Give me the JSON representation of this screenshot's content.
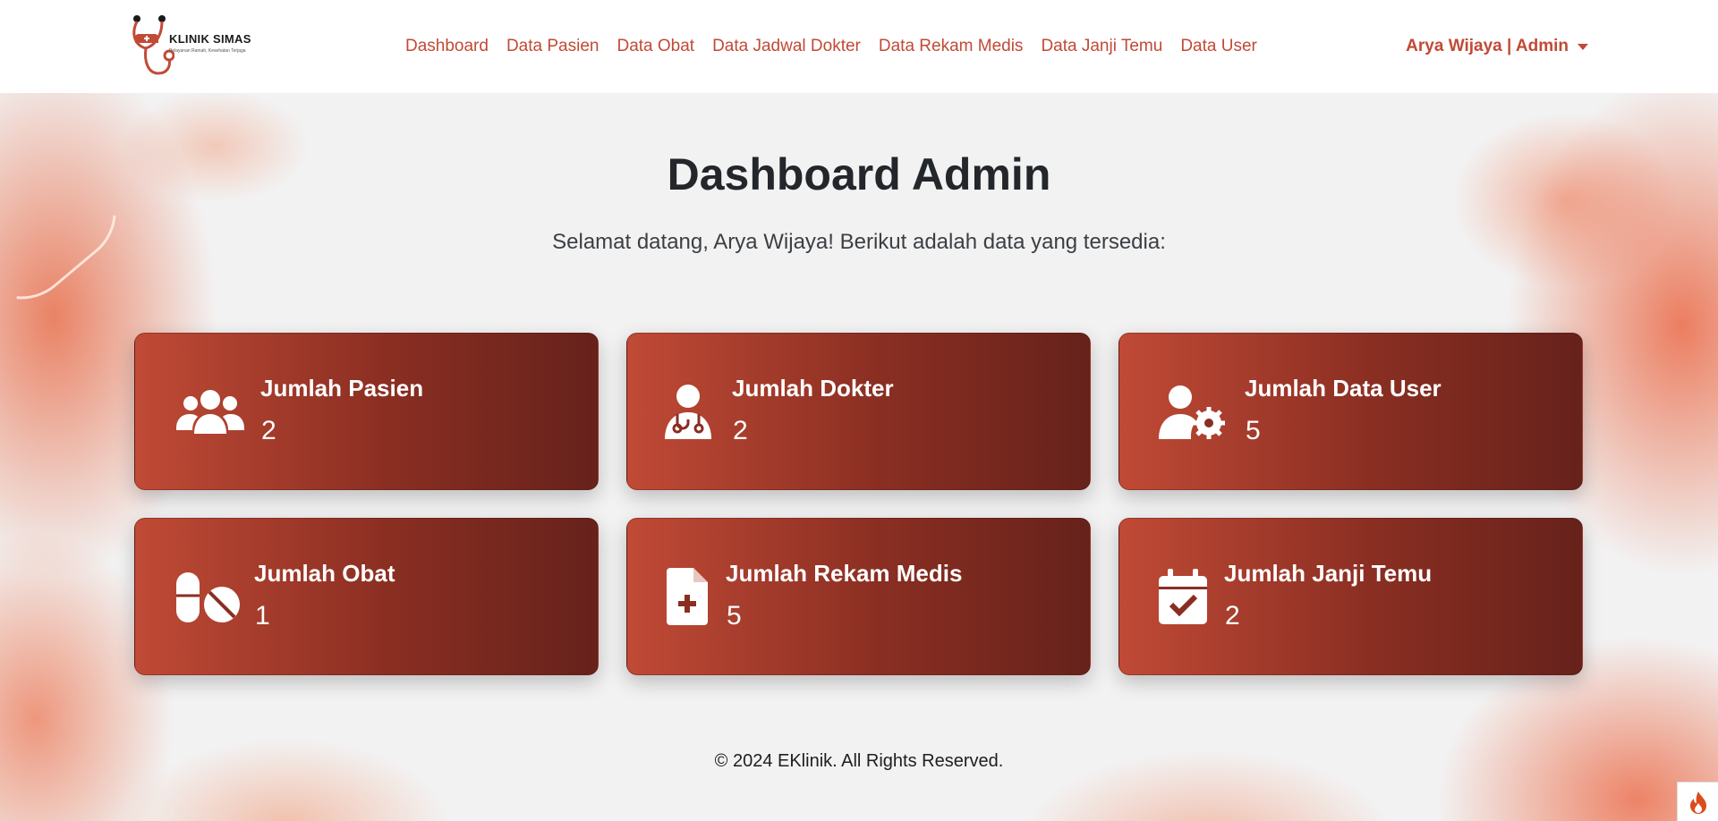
{
  "brand": {
    "name": "KLINIK SIMAS",
    "tagline": "Pelayanan Ramah, Kesehatan Terjaga"
  },
  "nav": {
    "links": [
      {
        "label": "Dashboard"
      },
      {
        "label": "Data Pasien"
      },
      {
        "label": "Data Obat"
      },
      {
        "label": "Data Jadwal Dokter"
      },
      {
        "label": "Data Rekam Medis"
      },
      {
        "label": "Data Janji Temu"
      },
      {
        "label": "Data User"
      }
    ],
    "user_label": "Arya Wijaya | Admin"
  },
  "main": {
    "title": "Dashboard Admin",
    "subtitle": "Selamat datang, Arya Wijaya! Berikut adalah data yang tersedia:"
  },
  "cards": [
    {
      "title": "Jumlah Pasien",
      "value": "2",
      "icon": "users-icon"
    },
    {
      "title": "Jumlah Dokter",
      "value": "2",
      "icon": "doctor-icon"
    },
    {
      "title": "Jumlah Data User",
      "value": "5",
      "icon": "user-gear-icon"
    },
    {
      "title": "Jumlah Obat",
      "value": "1",
      "icon": "pills-icon"
    },
    {
      "title": "Jumlah Rekam Medis",
      "value": "5",
      "icon": "medical-file-icon"
    },
    {
      "title": "Jumlah Janji Temu",
      "value": "2",
      "icon": "calendar-check-icon"
    }
  ],
  "footer": {
    "text": "© 2024 EKlinik. All Rights Reserved."
  },
  "colors": {
    "accent": "#c14a37",
    "card_start": "#c04a36",
    "card_end": "#66221b"
  }
}
